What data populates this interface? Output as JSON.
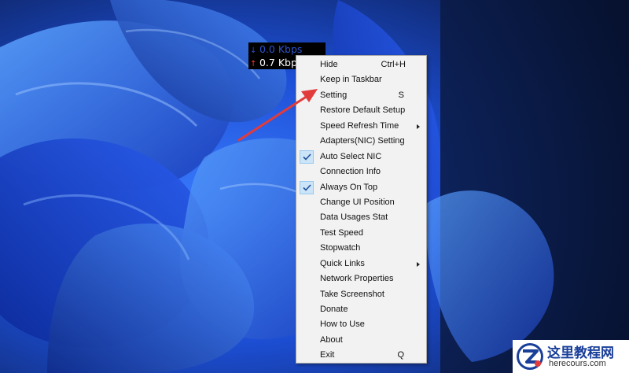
{
  "speed_widget": {
    "download": "0.0 Kbps",
    "upload": "0.7 Kbps",
    "download_icon": "arrow-down-icon",
    "upload_icon": "arrow-up-icon"
  },
  "menu": {
    "items": [
      {
        "label": "Hide",
        "shortcut": "Ctrl+H"
      },
      {
        "label": "Keep in Taskbar"
      },
      {
        "label": "Setting",
        "shortcut": "S"
      },
      {
        "label": "Restore Default Setup"
      },
      {
        "label": "Speed Refresh Time",
        "submenu": true
      },
      {
        "label": "Adapters(NIC) Setting"
      },
      {
        "label": "Auto Select NIC",
        "checked": true
      },
      {
        "label": "Connection Info"
      },
      {
        "label": "Always On Top",
        "checked": true
      },
      {
        "label": "Change UI Position"
      },
      {
        "label": "Data Usages Stat"
      },
      {
        "label": "Test Speed"
      },
      {
        "label": "Stopwatch"
      },
      {
        "label": "Quick Links",
        "submenu": true
      },
      {
        "label": "Network Properties"
      },
      {
        "label": "Take Screenshot"
      },
      {
        "label": "Donate"
      },
      {
        "label": "How to Use"
      },
      {
        "label": "About"
      },
      {
        "label": "Exit",
        "shortcut": "Q"
      }
    ]
  },
  "watermark": {
    "title": "这里教程网",
    "subtitle": "herecours.com"
  },
  "colors": {
    "annotation_arrow": "#e23b3b",
    "check_highlight": "#cce4f7",
    "menu_background": "#f2f2f2"
  }
}
